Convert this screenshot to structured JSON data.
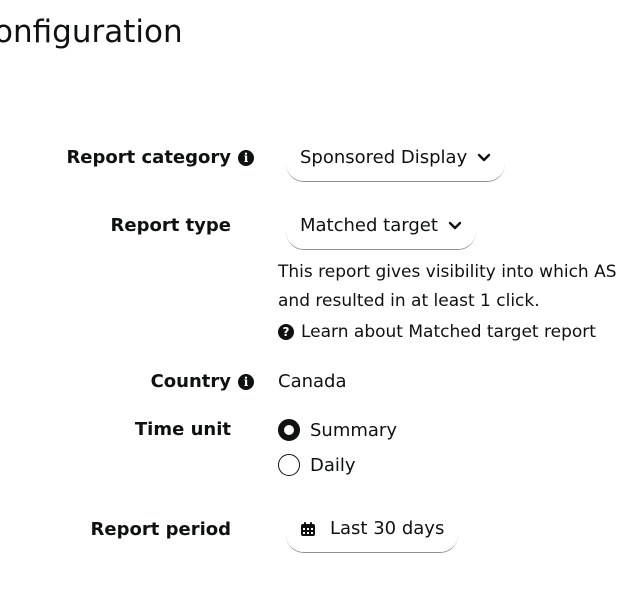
{
  "page": {
    "title": "onfiguration"
  },
  "form": {
    "report_category": {
      "label": "Report category",
      "value": "Sponsored Display"
    },
    "report_type": {
      "label": "Report type",
      "value": "Matched target",
      "description_line1": "This report gives visibility into which AS",
      "description_line2": "and resulted in at least 1 click.",
      "help_link": "Learn about Matched target report"
    },
    "country": {
      "label": "Country",
      "value": "Canada"
    },
    "time_unit": {
      "label": "Time unit",
      "options": [
        {
          "label": "Summary",
          "selected": true
        },
        {
          "label": "Daily",
          "selected": false
        }
      ]
    },
    "report_period": {
      "label": "Report period",
      "value": "Last 30 days"
    }
  },
  "icons": {
    "info": "info-icon",
    "chevron": "chevron-down-icon",
    "help": "question-circle-icon",
    "calendar": "calendar-icon"
  }
}
